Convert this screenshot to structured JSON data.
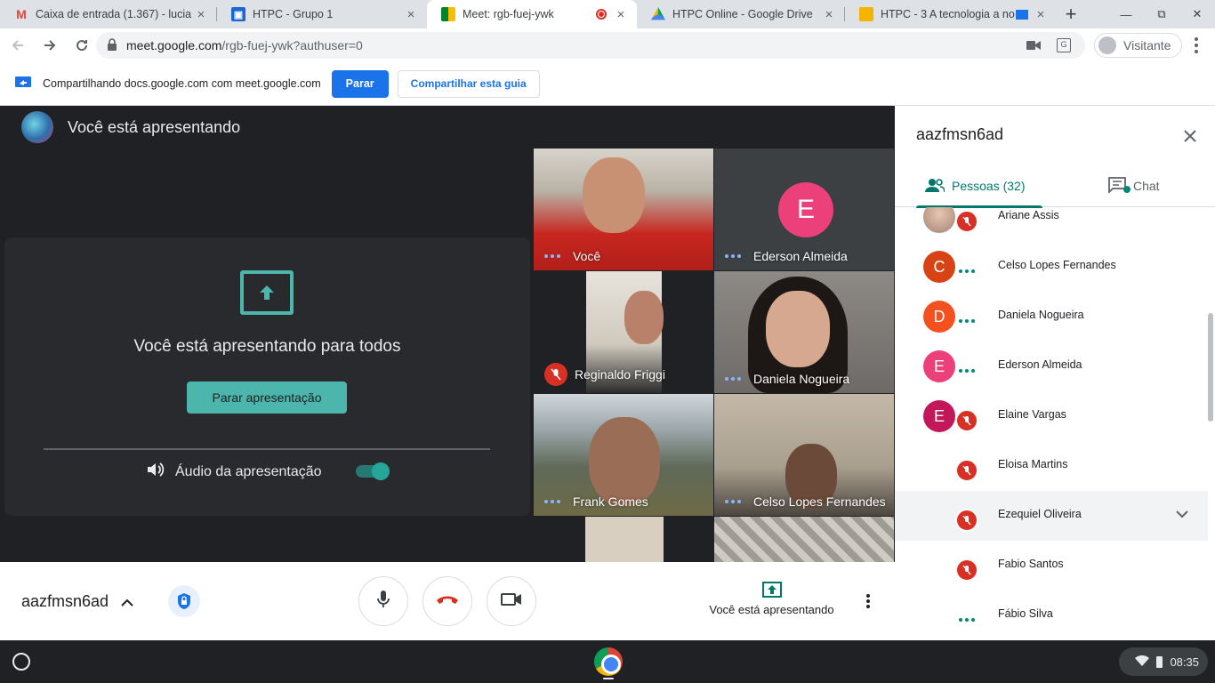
{
  "browser": {
    "tabs": [
      {
        "title": "Caixa de entrada (1.367) - lucia",
        "favicon": "gmail-icon"
      },
      {
        "title": "HTPC - Grupo 1",
        "favicon": "classroom-icon"
      },
      {
        "title": "Meet: rgb-fuej-ywk",
        "favicon": "meet-icon",
        "active": true
      },
      {
        "title": "HTPC Online - Google Drive",
        "favicon": "drive-icon"
      },
      {
        "title": "HTPC - 3 A tecnologia a no",
        "favicon": "slides-icon"
      }
    ],
    "url_host": "meet.google.com",
    "url_path": "/rgb-fuej-ywk?authuser=0",
    "profile_label": "Visitante"
  },
  "infobar": {
    "text": "Compartilhando docs.google.com com meet.google.com",
    "stop_label": "Parar",
    "share_tab_label": "Compartilhar esta guia"
  },
  "stage": {
    "header": "Você está apresentando",
    "card_message": "Você está apresentando para todos",
    "stop_presenting_label": "Parar apresentação",
    "audio_label": "Áudio da apresentação",
    "audio_on": true
  },
  "tiles": [
    {
      "name": "Você",
      "state": "dots"
    },
    {
      "name": "Ederson Almeida",
      "state": "dots",
      "initial": "E"
    },
    {
      "name": "Reginaldo Friggi",
      "state": "muted"
    },
    {
      "name": "Daniela Nogueira",
      "state": "dots"
    },
    {
      "name": "Frank Gomes",
      "state": "dots"
    },
    {
      "name": "Celso Lopes Fernandes",
      "state": "dots"
    }
  ],
  "bottombar": {
    "meeting_code": "aazfmsn6ad",
    "presenting_label": "Você está apresentando"
  },
  "panel": {
    "title": "aazfmsn6ad",
    "people_tab": "Pessoas (32)",
    "chat_tab": "Chat",
    "people": [
      {
        "name": "Ariane Assis",
        "initial": "",
        "color": "#c8b4a8",
        "status": "muted"
      },
      {
        "name": "Celso Lopes Fernandes",
        "initial": "C",
        "color": "#d84315",
        "status": "dots"
      },
      {
        "name": "Daniela Nogueira",
        "initial": "D",
        "color": "#f4511e",
        "status": "dots"
      },
      {
        "name": "Ederson Almeida",
        "initial": "E",
        "color": "#ec407a",
        "status": "dots"
      },
      {
        "name": "Elaine Vargas",
        "initial": "E",
        "color": "#c2185b",
        "status": "muted"
      },
      {
        "name": "Eloisa Martins",
        "initial": "",
        "color": "",
        "status": "muted"
      },
      {
        "name": "Ezequiel Oliveira",
        "initial": "",
        "color": "",
        "status": "muted"
      },
      {
        "name": "Fabio Santos",
        "initial": "",
        "color": "",
        "status": "muted"
      },
      {
        "name": "Fábio Silva",
        "initial": "",
        "color": "",
        "status": "dots"
      }
    ]
  },
  "shelf": {
    "time": "08:35"
  },
  "colors": {
    "accent": "#00796b",
    "teal_button": "#4db6ac",
    "mute_red": "#d93025",
    "blue": "#1a73e8"
  }
}
